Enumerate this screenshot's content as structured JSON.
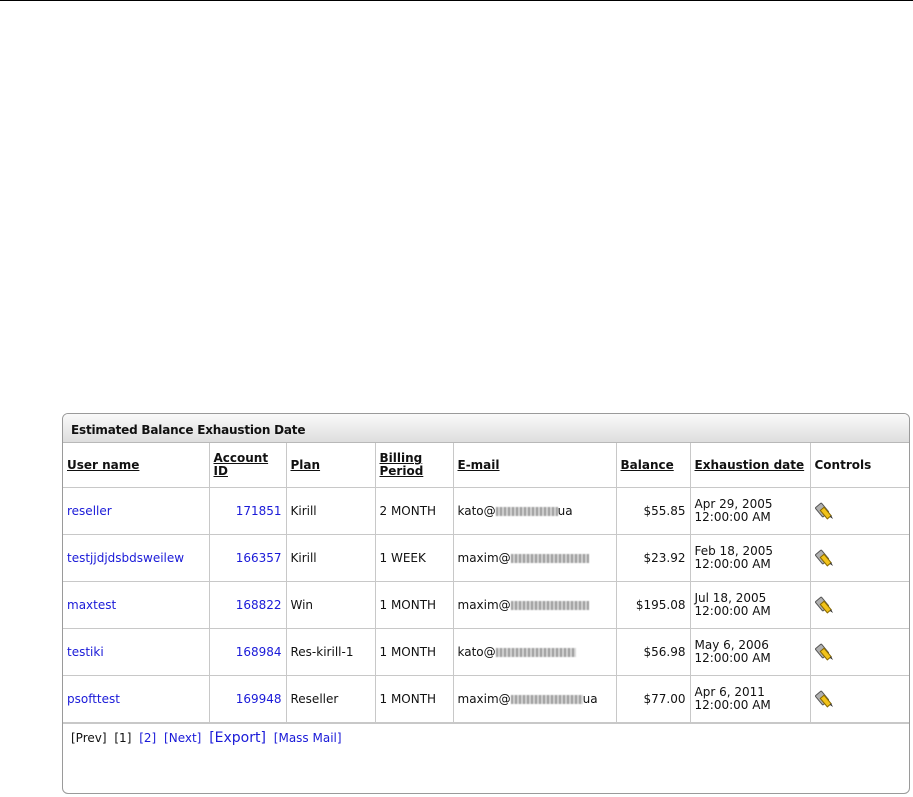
{
  "panel": {
    "title": "Estimated Balance Exhaustion Date"
  },
  "table": {
    "headers": {
      "user_name": "User name",
      "account_id": "Account ID",
      "plan": "Plan",
      "billing_period": "Billing Period",
      "email": "E-mail",
      "balance": "Balance",
      "exhaustion_date": "Exhaustion date",
      "controls": "Controls"
    },
    "rows": [
      {
        "user_name": "reseller",
        "account_id": "171851",
        "plan": "Kirill",
        "billing_period": "2 MONTH",
        "email_user": "kato@",
        "email_tld": "ua",
        "balance": "$55.85",
        "date_line1": "Apr 29, 2005",
        "date_line2": "12:00:00 AM",
        "control_icon": "edit-icon"
      },
      {
        "user_name": "testjjdjdsbdsweilew",
        "account_id": "166357",
        "plan": "Kirill",
        "billing_period": "1 WEEK",
        "email_user": "maxim@",
        "email_tld": "",
        "balance": "$23.92",
        "date_line1": "Feb 18, 2005",
        "date_line2": "12:00:00 AM",
        "control_icon": "edit-icon"
      },
      {
        "user_name": "maxtest",
        "account_id": "168822",
        "plan": "Win",
        "billing_period": "1 MONTH",
        "email_user": "maxim@",
        "email_tld": "",
        "balance": "$195.08",
        "date_line1": "Jul 18, 2005",
        "date_line2": "12:00:00 AM",
        "control_icon": "edit-icon"
      },
      {
        "user_name": "testiki",
        "account_id": "168984",
        "plan": "Res-kirill-1",
        "billing_period": "1 MONTH",
        "email_user": "kato@",
        "email_tld": "",
        "balance": "$56.98",
        "date_line1": "May 6, 2006",
        "date_line2": "12:00:00 AM",
        "control_icon": "edit-icon"
      },
      {
        "user_name": "psofttest",
        "account_id": "169948",
        "plan": "Reseller",
        "billing_period": "1 MONTH",
        "email_user": "maxim@",
        "email_tld": "ua",
        "balance": "$77.00",
        "date_line1": "Apr 6, 2011",
        "date_line2": "12:00:00 AM",
        "control_icon": "edit-icon"
      }
    ]
  },
  "pager": {
    "prev": "[Prev]",
    "current": "[1]",
    "page2": "[2]",
    "next": "[Next]",
    "export": "[Export]",
    "mass_mail": "[Mass Mail]"
  },
  "colors": {
    "link": "#1a1ad8",
    "border": "#c8c8c8",
    "header_gradient_top": "#fafafa",
    "header_gradient_bottom": "#dedede"
  }
}
